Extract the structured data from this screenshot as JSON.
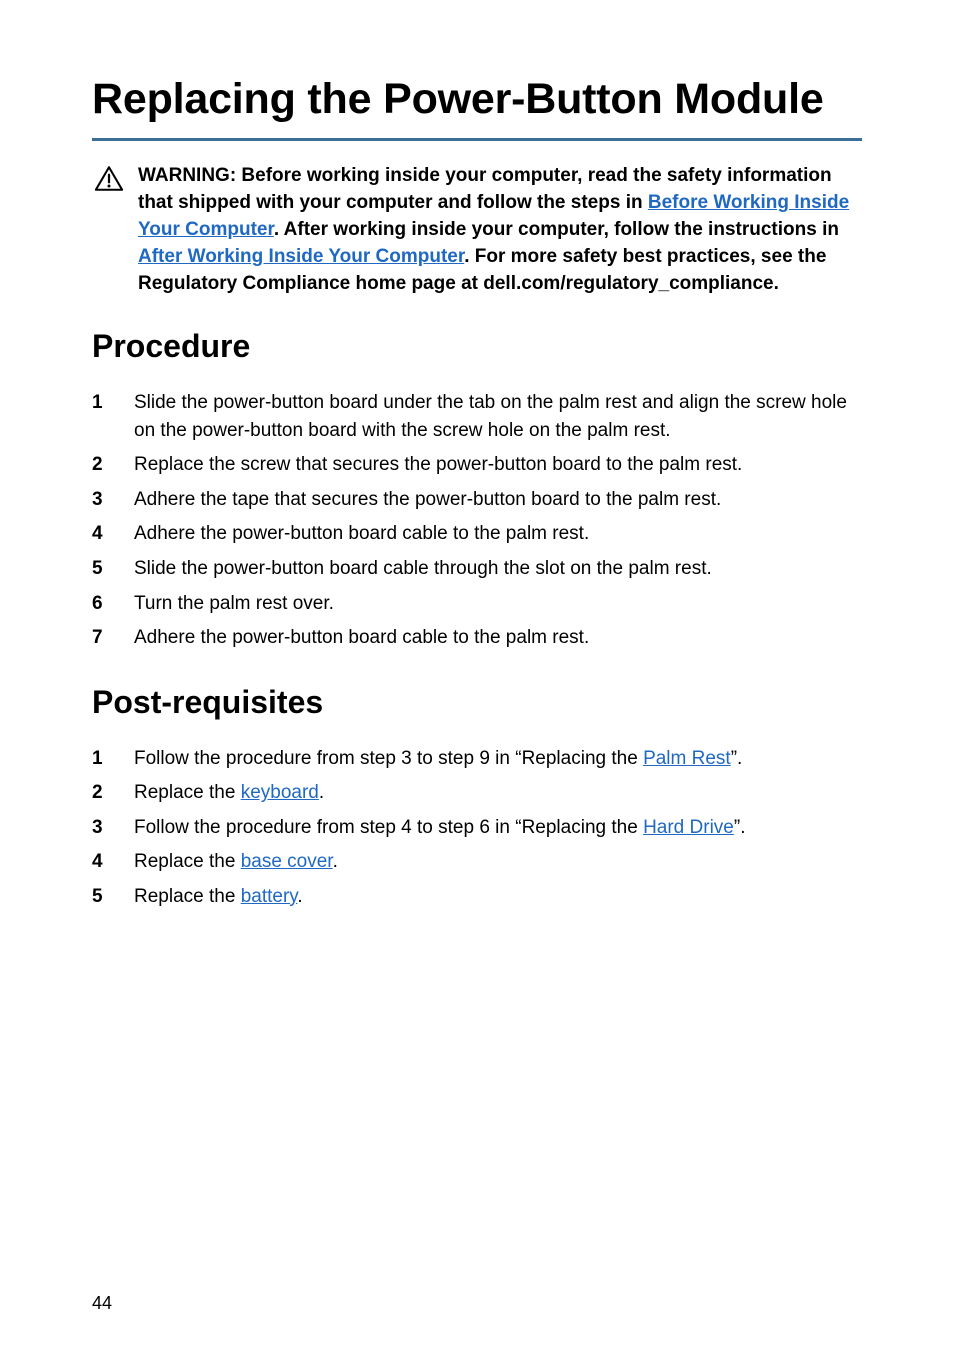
{
  "title": "Replacing the Power-Button Module",
  "warning": {
    "parts": [
      {
        "text": "WARNING: Before working inside your computer, read the safety information that shipped with your computer and follow the steps in "
      },
      {
        "text": "Before Working Inside Your Computer",
        "link": true
      },
      {
        "text": ". After working inside your computer, follow the instructions in "
      },
      {
        "text": "After Working Inside Your Computer",
        "link": true
      },
      {
        "text": ". For more safety best practices, see the Regulatory Compliance home page at dell.com/regulatory_compliance."
      }
    ]
  },
  "sections": {
    "procedure": {
      "heading": "Procedure",
      "steps": [
        "Slide the power-button board under the tab on the palm rest and align the screw hole on the power-button board with the screw hole on the palm rest.",
        "Replace the screw that secures the power-button board to the palm rest.",
        "Adhere the tape that secures the power-button board to the palm rest.",
        "Adhere the power-button board cable to the palm rest.",
        "Slide the power-button board cable through the slot on the palm rest.",
        "Turn the palm rest over.",
        "Adhere the power-button board cable to the palm rest."
      ]
    },
    "postreq": {
      "heading": "Post-requisites",
      "steps": [
        [
          {
            "text": "Follow the procedure from step 3 to step 9 in “Replacing the "
          },
          {
            "text": "Palm Rest",
            "link": true
          },
          {
            "text": "”."
          }
        ],
        [
          {
            "text": "Replace the "
          },
          {
            "text": "keyboard",
            "link": true
          },
          {
            "text": "."
          }
        ],
        [
          {
            "text": "Follow the procedure from step 4 to step 6 in “Replacing the "
          },
          {
            "text": "Hard Drive",
            "link": true
          },
          {
            "text": "”."
          }
        ],
        [
          {
            "text": "Replace the "
          },
          {
            "text": "base cover",
            "link": true
          },
          {
            "text": "."
          }
        ],
        [
          {
            "text": "Replace the "
          },
          {
            "text": "battery",
            "link": true
          },
          {
            "text": "."
          }
        ]
      ]
    }
  },
  "page_number": "44"
}
